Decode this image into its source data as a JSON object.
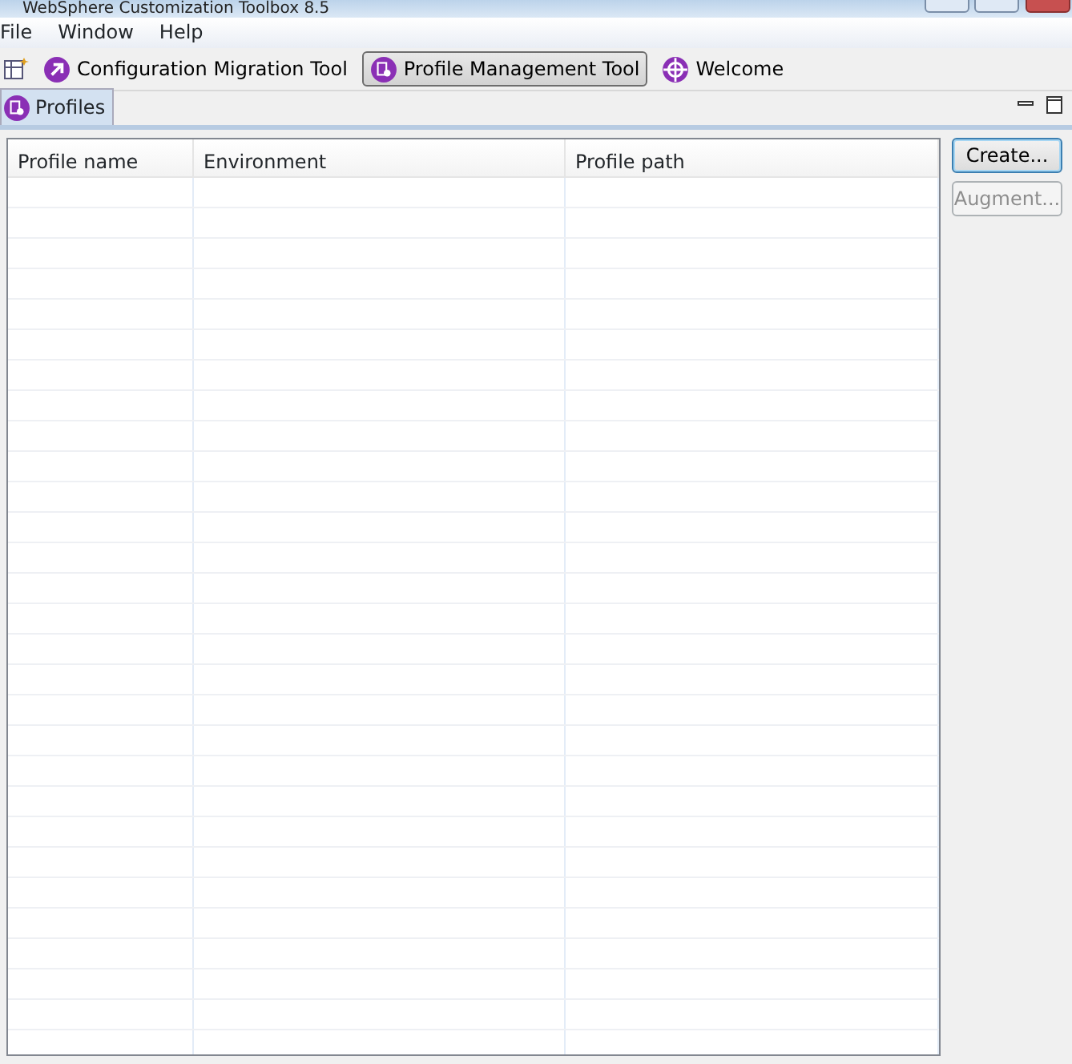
{
  "window": {
    "title": "WebSphere Customization Toolbox 8.5"
  },
  "menu": [
    "File",
    "Window",
    "Help"
  ],
  "toolbar": [
    {
      "label": "Configuration Migration Tool",
      "selected": false,
      "kind": "migration"
    },
    {
      "label": "Profile Management Tool",
      "selected": true,
      "kind": "profile"
    },
    {
      "label": "Welcome",
      "selected": false,
      "kind": "welcome"
    }
  ],
  "view": {
    "tab": "Profiles"
  },
  "table": {
    "columns": [
      "Profile name",
      "Environment",
      "Profile path"
    ]
  },
  "buttons": [
    {
      "label": "Create...",
      "disabled": false,
      "focused": true
    },
    {
      "label": "Augment...",
      "disabled": true,
      "focused": false
    }
  ]
}
